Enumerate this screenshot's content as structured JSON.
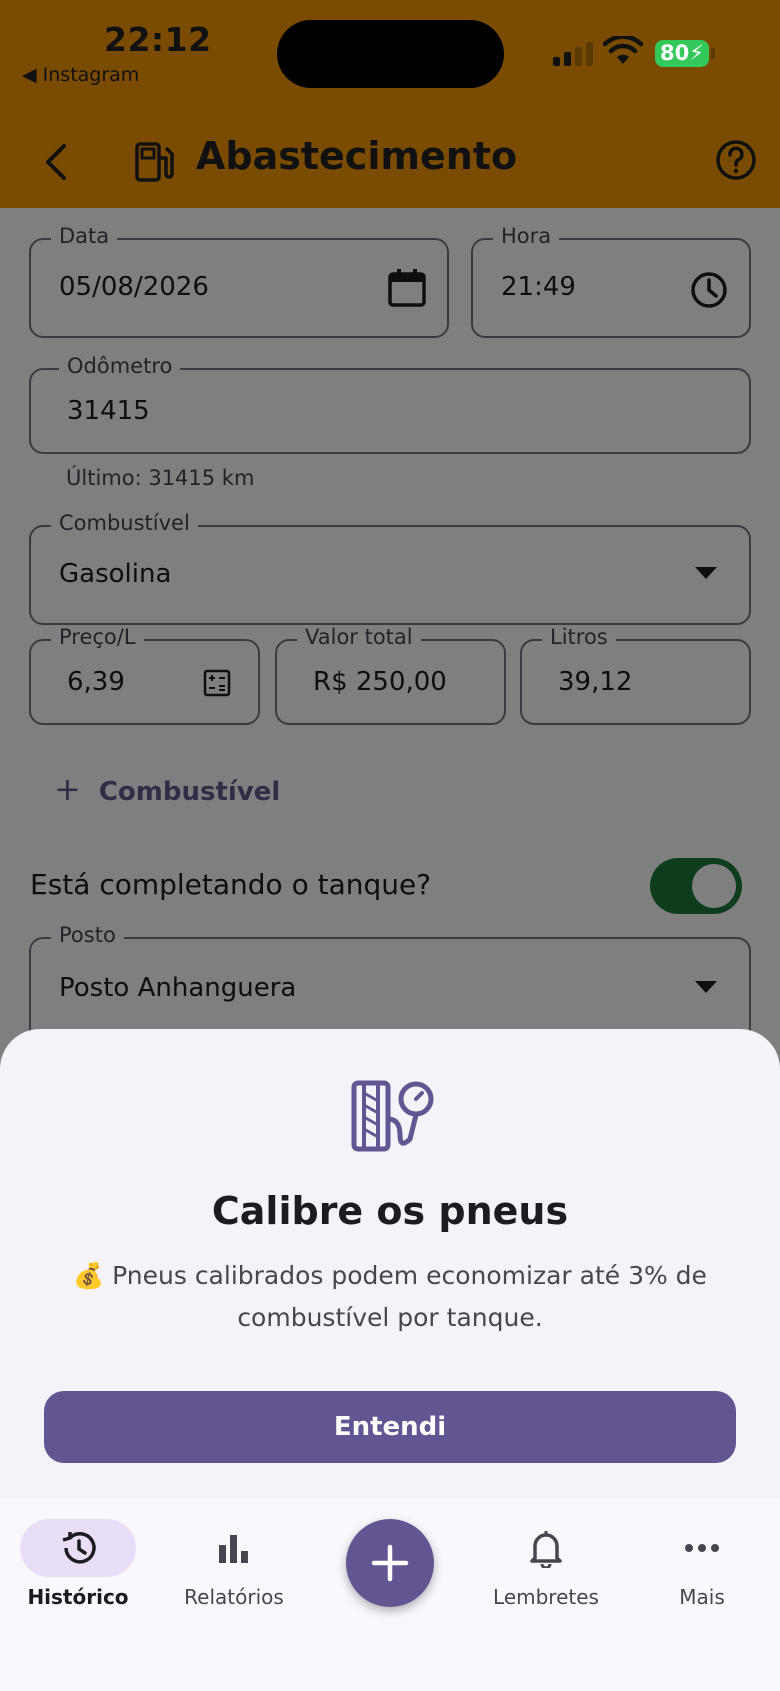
{
  "status": {
    "time": "22:12",
    "back_app": "◀ Instagram",
    "battery": "80"
  },
  "appbar": {
    "title": "Abastecimento"
  },
  "form": {
    "date": {
      "label": "Data",
      "value": "05/08/2026"
    },
    "time": {
      "label": "Hora",
      "value": "21:49"
    },
    "odometer": {
      "label": "Odômetro",
      "value": "31415",
      "helper": "Último: 31415 km"
    },
    "fuel": {
      "label": "Combustível",
      "value": "Gasolina"
    },
    "price": {
      "label": "Preço/L",
      "value": "6,39"
    },
    "total": {
      "label": "Valor total",
      "value": "R$ 250,00"
    },
    "liters": {
      "label": "Litros",
      "value": "39,12"
    },
    "add_fuel": "Combustível",
    "full_tank_question": "Está completando o tanque?",
    "full_tank": true,
    "station": {
      "label": "Posto",
      "value": "Posto Anhanguera"
    }
  },
  "sheet": {
    "title": "Calibre os pneus",
    "body": "💰 Pneus calibrados podem economizar até 3% de combustível por tanque.",
    "button": "Entendi"
  },
  "nav": {
    "items": [
      {
        "label": "Histórico",
        "active": true
      },
      {
        "label": "Relatórios",
        "active": false
      },
      {
        "label": "Lembretes",
        "active": false
      },
      {
        "label": "Mais",
        "active": false
      }
    ]
  },
  "colors": {
    "appbar": "#7a4b00",
    "accent": "#625591",
    "switch_on": "#1a7a3a"
  }
}
